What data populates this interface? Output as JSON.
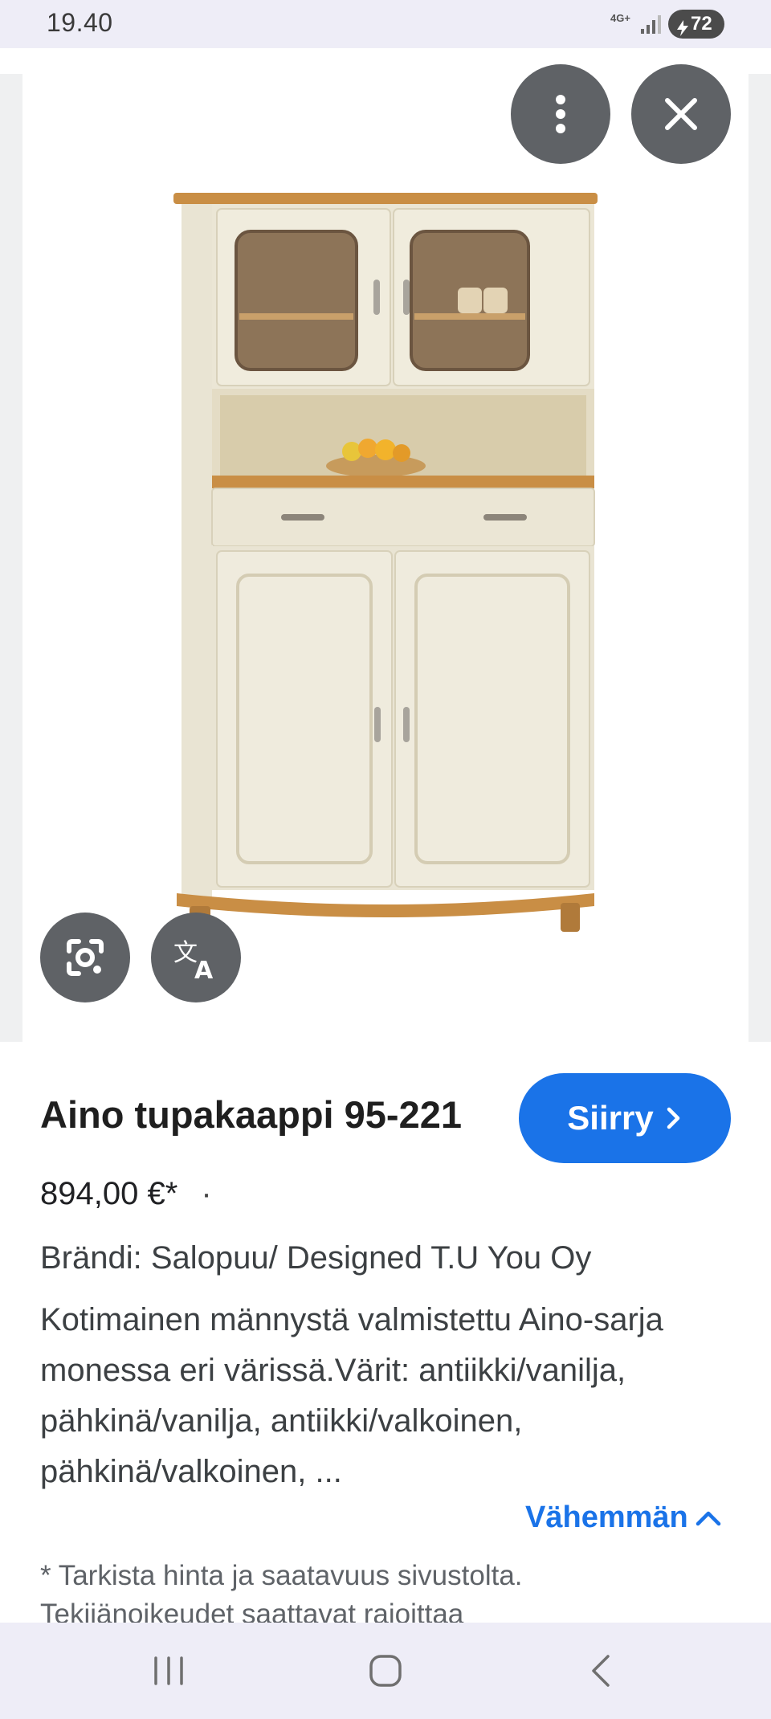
{
  "status_bar": {
    "time": "19.40",
    "network": "4G+",
    "battery": "72"
  },
  "viewer": {
    "image_alt": "Aino tupakaappi 95-221",
    "buttons": {
      "more": "more-vert-icon",
      "close": "close-icon",
      "lens": "google-lens-icon",
      "translate": "translate-icon"
    }
  },
  "product": {
    "title": "Aino tupakaappi 95-221",
    "goto_label": "Siirry",
    "price": "894,00 €*",
    "price_separator": "·",
    "brand": "Brändi: Salopuu/ Designed T.U You Oy",
    "description": "Kotimainen männystä valmistettu Aino-sarja monessa eri värissä.Värit: antiikki/vanilja, pähkinä/vanilja, antiikki/valkoinen, pähkinä/valkoinen, ...",
    "less_label": "Vähemmän",
    "disclaimer": "* Tarkista hinta ja saatavuus sivustolta. Tekijänoikeudet saattavat rajoittaa"
  },
  "colors": {
    "accent": "#1a73e8",
    "overlay_button": "#5f6266",
    "system_bar": "#eeedf7"
  }
}
